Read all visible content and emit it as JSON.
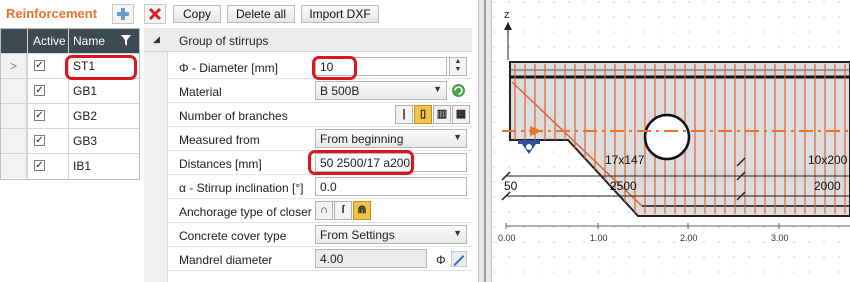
{
  "toolbar": {
    "title": "Reinforcement",
    "add_icon": "plus-icon",
    "delete_icon": "red-x-icon",
    "copy_label": "Copy",
    "delete_all_label": "Delete all",
    "import_label": "Import DXF"
  },
  "table": {
    "headers": {
      "active": "Active",
      "name": "Name"
    },
    "filter_icon": "filter-icon",
    "rows": [
      {
        "selector": ">",
        "active": true,
        "name": "ST1"
      },
      {
        "selector": "",
        "active": true,
        "name": "GB1"
      },
      {
        "selector": "",
        "active": true,
        "name": "GB2"
      },
      {
        "selector": "",
        "active": true,
        "name": "GB3"
      },
      {
        "selector": "",
        "active": true,
        "name": "IB1"
      }
    ]
  },
  "properties": {
    "group_title": "Group of stirrups",
    "diameter": {
      "label": "Φ - Diameter [mm]",
      "value": "10"
    },
    "material": {
      "label": "Material",
      "value": "B 500B"
    },
    "branches": {
      "label": "Number of branches",
      "icons": [
        "branches-1-icon",
        "branches-2-icon",
        "branches-3-icon",
        "branches-4-icon"
      ],
      "selected": 1
    },
    "measured_from": {
      "label": "Measured from",
      "value": "From beginning"
    },
    "distances": {
      "label": "Distances [mm]",
      "value": "50 2500/17 a200"
    },
    "inclination": {
      "label": "α - Stirrup inclination [°]",
      "value": "0.0"
    },
    "anchorage": {
      "label": "Anchorage type of closer",
      "icons": [
        "hook-closed-icon",
        "hook-open-icon",
        "hook-anchor-icon"
      ],
      "selected": 2
    },
    "cover_type": {
      "label": "Concrete cover type",
      "value": "From Settings"
    },
    "mandrel": {
      "label": "Mandrel diameter",
      "value": "4.00",
      "unit": "Φ",
      "edit_icon": "pencil-icon"
    }
  },
  "drawing": {
    "axis_z": "z",
    "label_spacing_1": "17x147",
    "label_spacing_2": "10x200",
    "dim_50": "50",
    "dim_2500": "2500",
    "dim_2000": "2000",
    "ticks": [
      "0.00",
      "1.00",
      "2.00",
      "3.00"
    ],
    "accent_orange": "#e8742a",
    "highlight_red": "#e0141b",
    "stirrup_color": "#d9663a"
  }
}
